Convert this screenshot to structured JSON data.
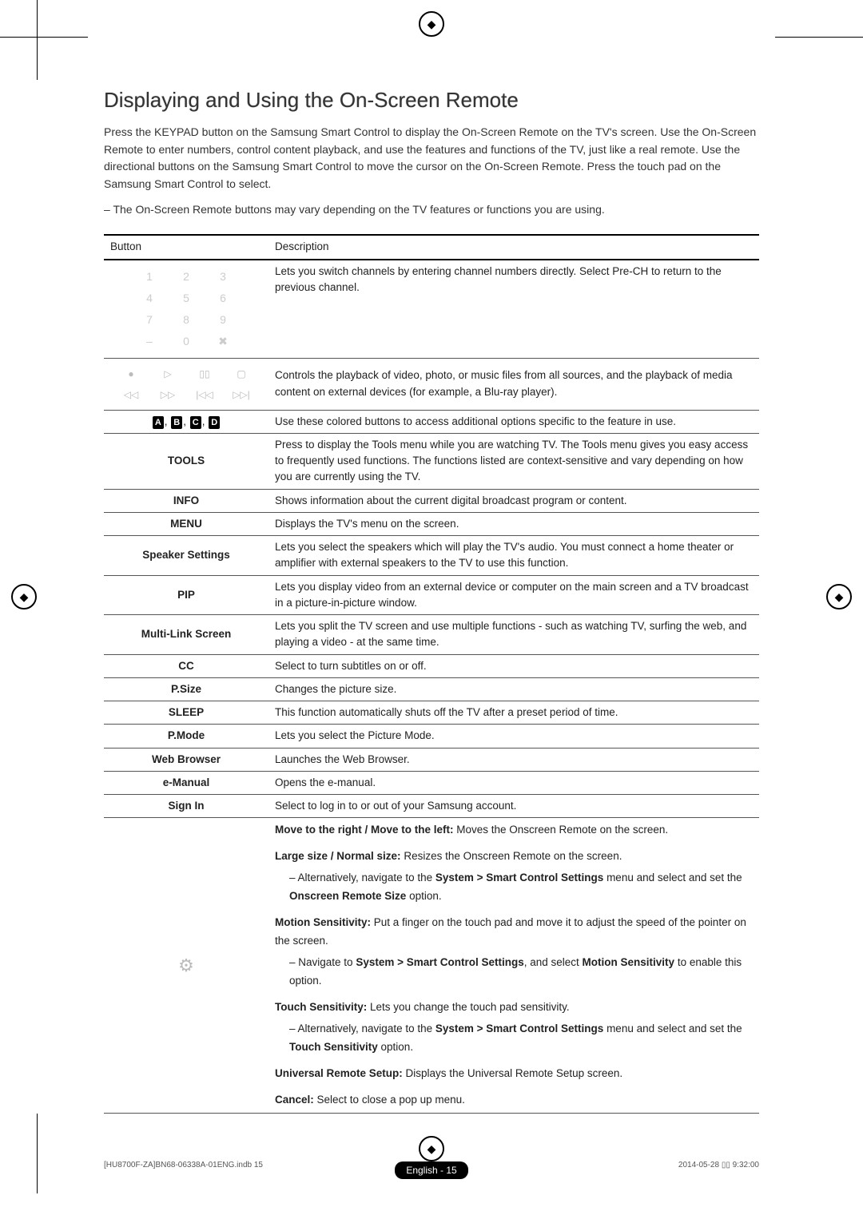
{
  "title": "Displaying and Using the On-Screen Remote",
  "intro": "Press the KEYPAD button on the Samsung Smart Control to display the On-Screen Remote on the TV's screen. Use the On-Screen Remote to enter numbers, control content playback, and use the features and functions of the TV, just like a real remote. Use the directional buttons on the Samsung Smart Control to move the cursor on the On-Screen Remote. Press the touch pad on the Samsung Smart Control to select.",
  "note": "The On-Screen Remote buttons may vary depending on the TV features or functions you are using.",
  "thead": {
    "c1": "Button",
    "c2": "Description"
  },
  "rows": {
    "keypad_desc": "Lets you switch channels by entering channel numbers directly. Select Pre-CH to return to the previous channel.",
    "playback_desc": "Controls the playback of video, photo, or music files from all sources, and the playback of media content on external devices (for example, a Blu-ray player).",
    "abcd_desc": "Use these colored buttons to access additional options specific to the feature in use.",
    "tools": {
      "label": "TOOLS",
      "desc": "Press to display the Tools menu while you are watching TV. The Tools menu gives you easy access to frequently used functions. The functions listed are context-sensitive and vary depending on how you are currently using the TV."
    },
    "info": {
      "label": "INFO",
      "desc": "Shows information about the current digital broadcast program or content."
    },
    "menu": {
      "label": "MENU",
      "desc": "Displays the TV's menu on the screen."
    },
    "speaker": {
      "label": "Speaker Settings",
      "desc": "Lets you select the speakers which will play the TV's audio. You must connect a home theater or amplifier with external speakers to the TV to use this function."
    },
    "pip": {
      "label": "PIP",
      "desc": "Lets you display video from an external device or computer on the main screen and a TV broadcast in a picture-in-picture window."
    },
    "mls": {
      "label": "Multi-Link Screen",
      "desc": "Lets you split the TV screen and use multiple functions - such as watching TV, surfing the web, and playing a video - at the same time."
    },
    "cc": {
      "label": "CC",
      "desc": "Select to turn subtitles on or off."
    },
    "psize": {
      "label": "P.Size",
      "desc": "Changes the picture size."
    },
    "sleep": {
      "label": "SLEEP",
      "desc": "This function automatically shuts off the TV after a preset period of time."
    },
    "pmode": {
      "label": "P.Mode",
      "desc": "Lets you select the Picture Mode."
    },
    "web": {
      "label": "Web Browser",
      "desc": "Launches the Web Browser."
    },
    "emanual": {
      "label": "e-Manual",
      "desc": "Opens the e-manual."
    },
    "signin": {
      "label": "Sign In",
      "desc": "Select to log in to or out of your Samsung account."
    },
    "settings": {
      "move_lbl": "Move to the right / Move to the left:",
      "move_txt": " Moves the Onscreen Remote on the screen.",
      "large_lbl": "Large size / Normal size:",
      "large_txt": " Resizes the Onscreen Remote on the screen.",
      "large_sub_a": "– Alternatively, navigate to the ",
      "large_sub_b": "System > Smart Control Settings",
      "large_sub_c": " menu and select and set the ",
      "large_sub_d": "Onscreen Remote Size",
      "large_sub_e": " option.",
      "motion_lbl": "Motion Sensitivity:",
      "motion_txt": " Put a finger on the touch pad and move it to adjust the speed of the pointer on the screen.",
      "motion_sub_a": "– Navigate to ",
      "motion_sub_b": "System > Smart Control Settings",
      "motion_sub_c": ", and select ",
      "motion_sub_d": "Motion Sensitivity",
      "motion_sub_e": " to enable this option.",
      "touch_lbl": "Touch Sensitivity:",
      "touch_txt": " Lets you change the touch pad sensitivity.",
      "touch_sub_a": "– Alternatively, navigate to the ",
      "touch_sub_b": "System > Smart Control Settings",
      "touch_sub_c": " menu and select and set the ",
      "touch_sub_d": "Touch Sensitivity",
      "touch_sub_e": " option.",
      "urs_lbl": "Universal Remote Setup:",
      "urs_txt": " Displays the Universal Remote Setup screen.",
      "cancel_lbl": "Cancel:",
      "cancel_txt": " Select to close a pop up menu."
    }
  },
  "keypad_keys": [
    "1",
    "2",
    "3",
    "4",
    "5",
    "6",
    "7",
    "8",
    "9",
    "–",
    "0",
    "✖"
  ],
  "playback_keys": [
    "●",
    "▷",
    "▯▯",
    "▢",
    "◁◁",
    "▷▷",
    "|◁◁",
    "▷▷|"
  ],
  "abcd": {
    "a": "A",
    "b": "B",
    "c": "C",
    "d": "D"
  },
  "footer": "English - 15",
  "meta_left": "[HU8700F-ZA]BN68-06338A-01ENG.indb   15",
  "meta_right": "2014-05-28   ▯▯ 9:32:00"
}
